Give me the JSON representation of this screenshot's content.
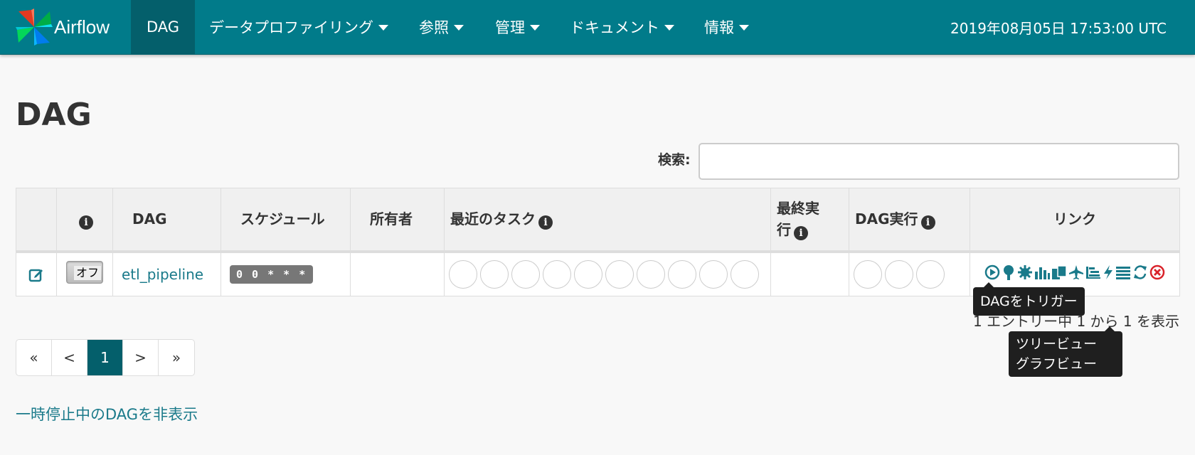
{
  "nav": {
    "brand": "Airflow",
    "items": [
      {
        "label": "DAG",
        "active": true
      },
      {
        "label": "データプロファイリング",
        "dropdown": true
      },
      {
        "label": "参照",
        "dropdown": true
      },
      {
        "label": "管理",
        "dropdown": true
      },
      {
        "label": "ドキュメント",
        "dropdown": true
      },
      {
        "label": "情報",
        "dropdown": true
      }
    ],
    "time": "2019年08月05日 17:53:00 UTC"
  },
  "page": {
    "title": "DAG",
    "search_label": "検索:",
    "search_value": ""
  },
  "table": {
    "headers": {
      "info": "i",
      "dag": "DAG",
      "schedule": "スケジュール",
      "owner": "所有者",
      "recent_tasks": "最近のタスク",
      "last_run_line1": "最終実",
      "last_run_line2": "行",
      "dag_runs": "DAG実行",
      "links": "リンク"
    },
    "rows": [
      {
        "toggle": "オフ",
        "dag_id": "etl_pipeline",
        "schedule": "0 0 * * *",
        "owner": "",
        "recent_task_circles": 10,
        "dag_run_circles": 3
      }
    ],
    "link_icons": [
      "trigger-icon",
      "tree-icon",
      "graph-icon",
      "duration-icon",
      "tries-icon",
      "landing-icon",
      "gantt-icon",
      "code-icon",
      "logs-icon",
      "refresh-icon",
      "delete-icon"
    ]
  },
  "tooltips": {
    "trigger": "DAGをトリガー",
    "tree": "ツリービュー",
    "graph": "グラフビュー"
  },
  "table_info": "1 エントリー中 1 から 1 を表示",
  "pagination": {
    "first": "«",
    "prev": "<",
    "current": "1",
    "next": ">",
    "last": "»"
  },
  "hide_paused": "一時停止中のDAGを非表示",
  "colors": {
    "navbar": "#017b8a",
    "nav_active": "#045f6b",
    "link": "#1a7a8a",
    "delete": "#d9222a"
  }
}
